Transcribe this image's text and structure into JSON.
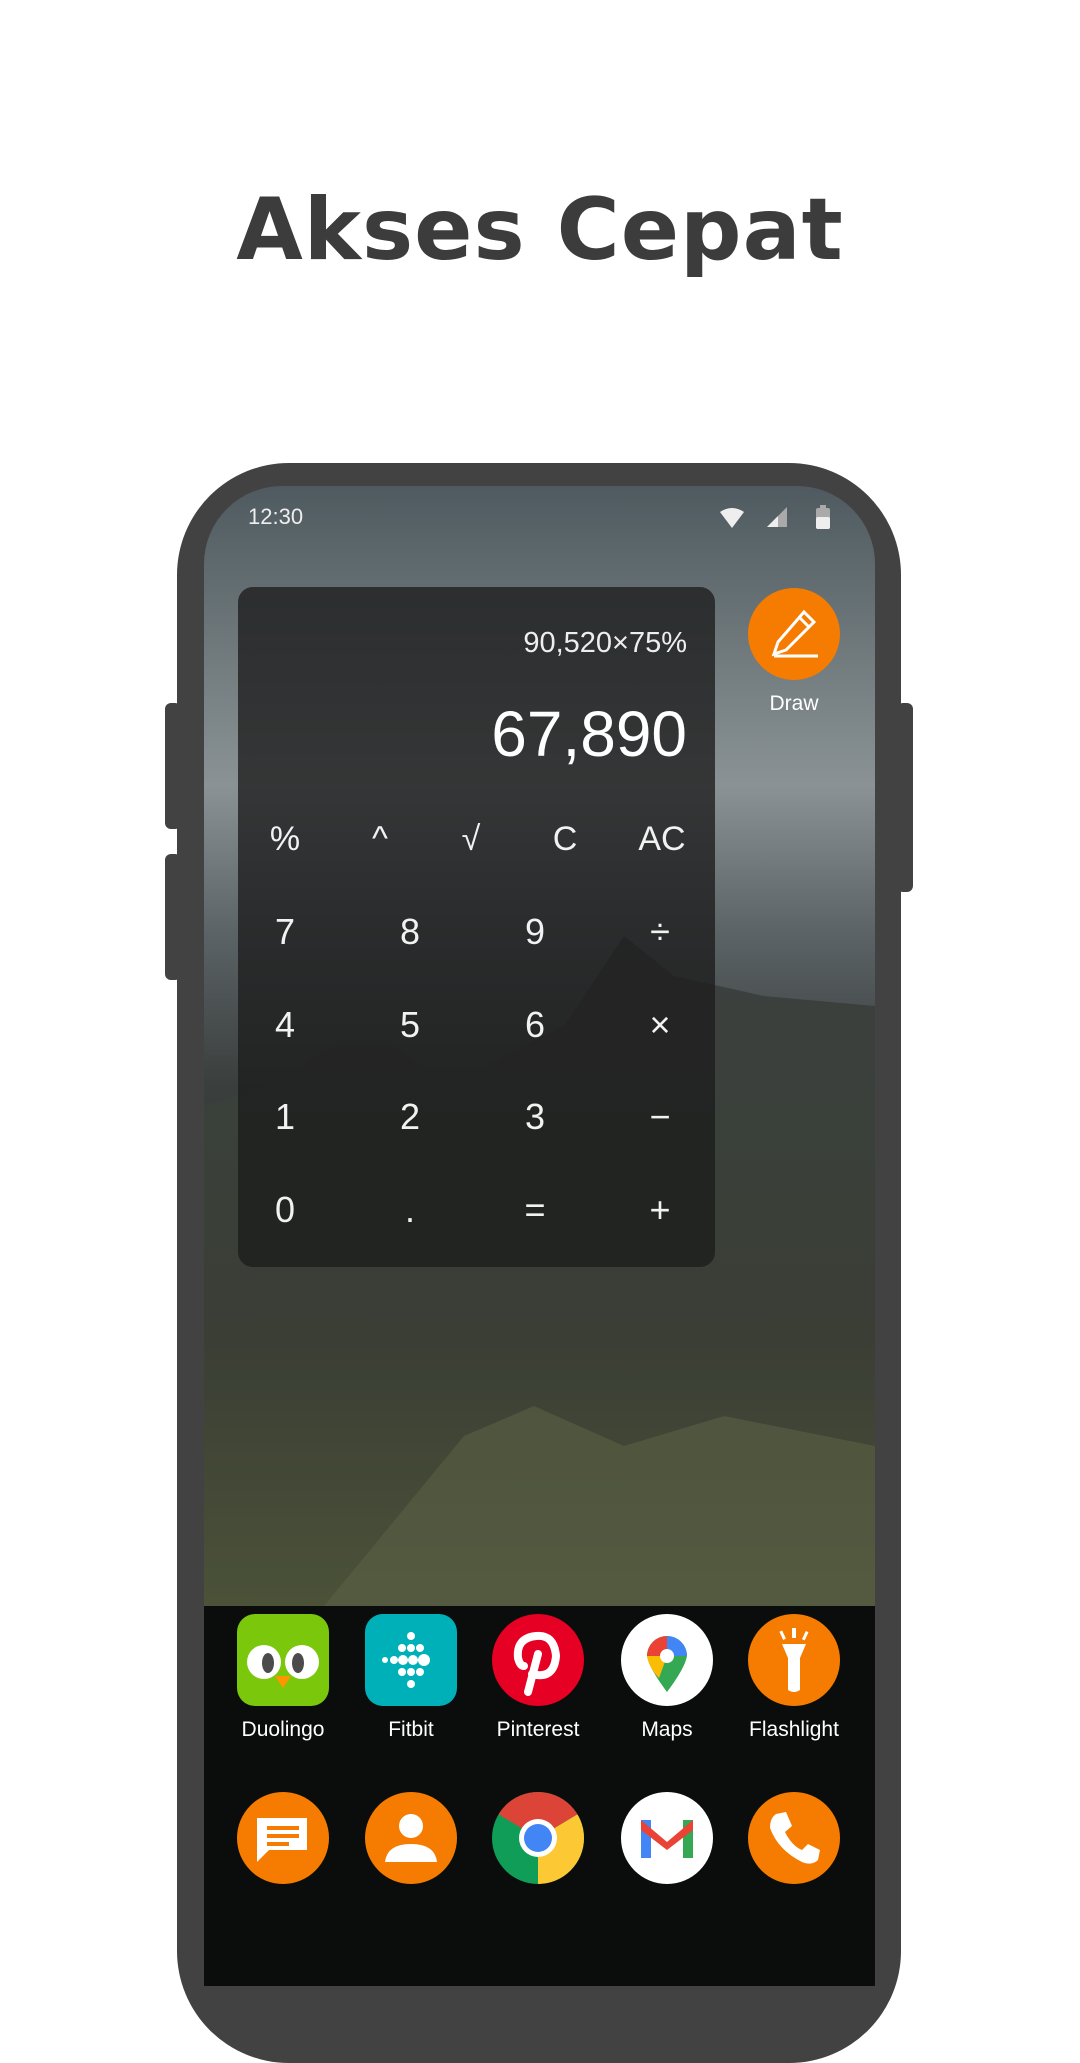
{
  "title": "Akses Cepat",
  "status": {
    "time": "12:30",
    "icons": [
      "wifi-icon",
      "signal-icon",
      "battery-icon"
    ]
  },
  "calculator": {
    "expression": "90,520×75%",
    "result": "67,890",
    "rows": [
      [
        "%",
        "^",
        "√",
        "C",
        "AC"
      ],
      [
        "7",
        "8",
        "9",
        "÷"
      ],
      [
        "4",
        "5",
        "6",
        "×"
      ],
      [
        "1",
        "2",
        "3",
        "−"
      ],
      [
        "0",
        ".",
        "=",
        "+"
      ]
    ]
  },
  "draw": {
    "label": "Draw",
    "color": "#f57c00"
  },
  "apps_row1": [
    {
      "label": "Duolingo"
    },
    {
      "label": "Fitbit"
    },
    {
      "label": "Pinterest"
    },
    {
      "label": "Maps"
    },
    {
      "label": "Flashlight"
    }
  ],
  "dock": [
    "messages-icon",
    "contacts-icon",
    "chrome-icon",
    "gmail-icon",
    "phone-icon"
  ],
  "colors": {
    "accent": "#f57c00",
    "frame": "#424242"
  }
}
